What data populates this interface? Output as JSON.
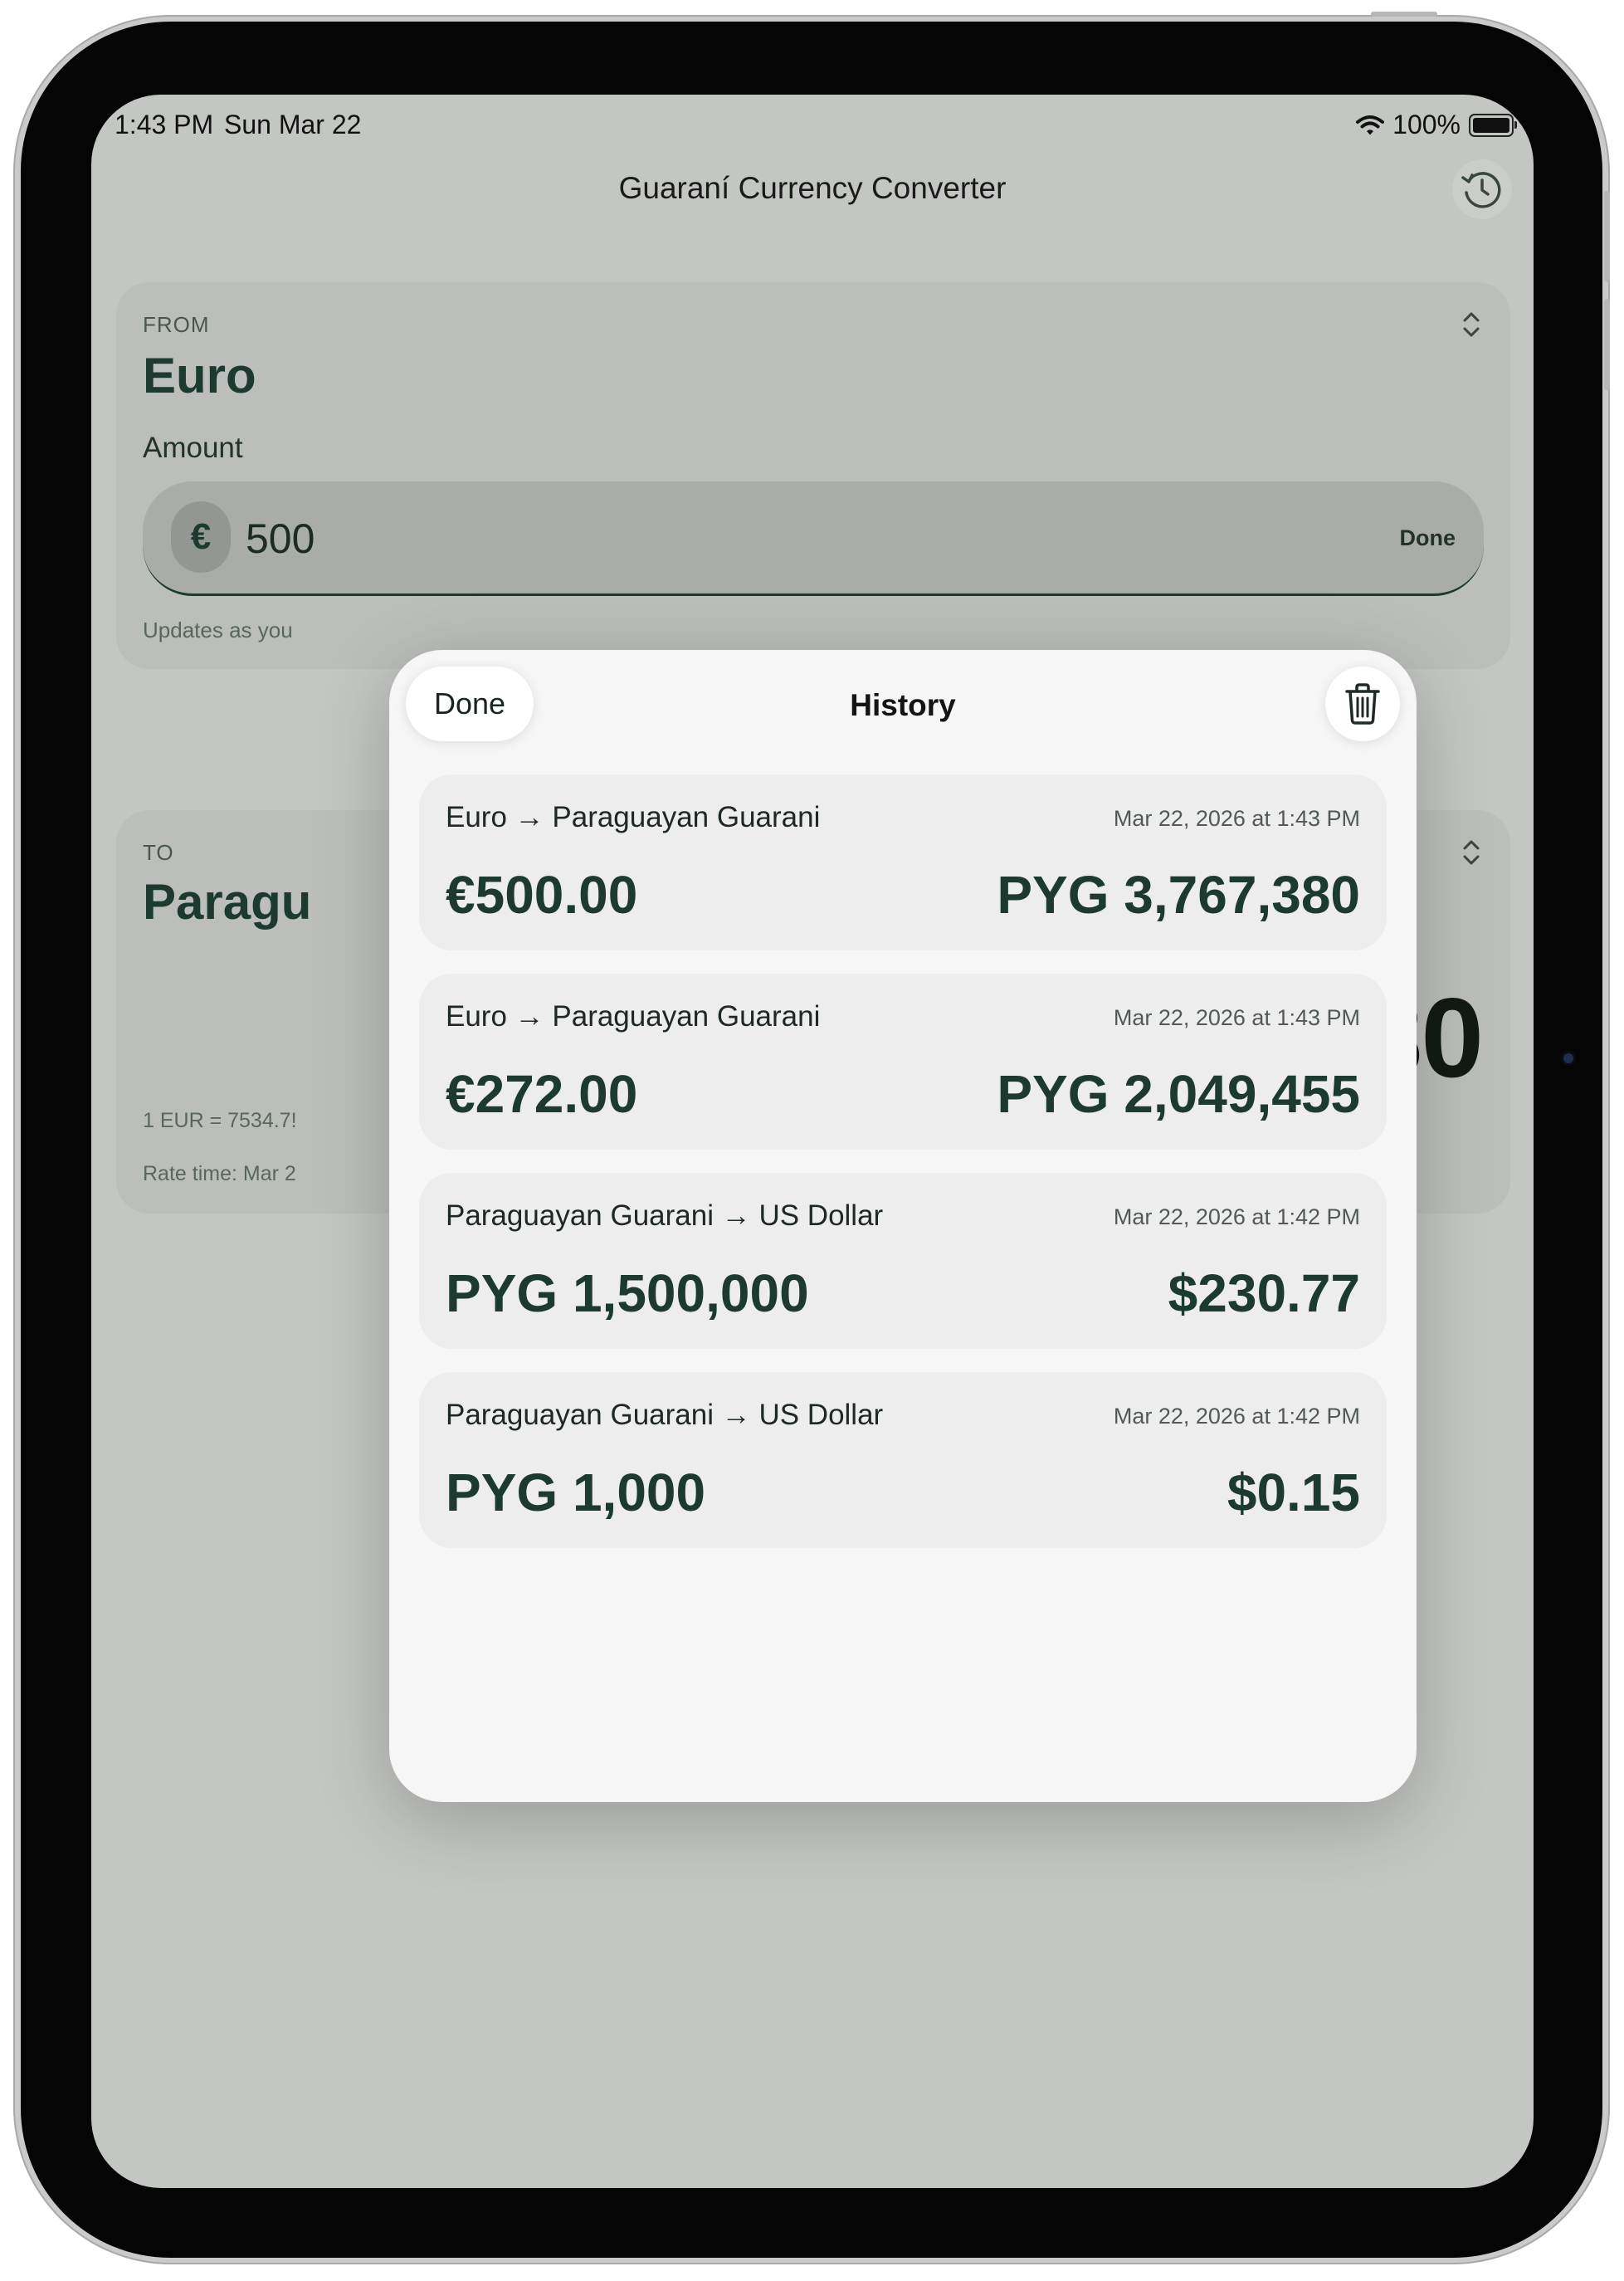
{
  "status_bar": {
    "time": "1:43 PM",
    "date": "Sun Mar 22",
    "battery": "100%"
  },
  "nav": {
    "title": "Guaraní Currency Converter",
    "history_icon": "clock-history-icon"
  },
  "from_card": {
    "label": "FROM",
    "currency": "Euro",
    "amount_label": "Amount",
    "currency_symbol": "€",
    "amount_value": "500",
    "done_label": "Done",
    "helper_text": "Updates as you"
  },
  "to_card": {
    "label": "TO",
    "currency": "Paragu",
    "result_visible": "380",
    "rate": "1 EUR = 7534.7!",
    "rate_time": "Rate time: Mar 2"
  },
  "history_modal": {
    "done_label": "Done",
    "title": "History",
    "clear_icon": "trash-icon",
    "items": [
      {
        "pair": "Euro → Paraguayan Guarani",
        "time": "Mar 22, 2026 at 1:43 PM",
        "from_amount": "€500.00",
        "to_amount": "PYG 3,767,380"
      },
      {
        "pair": "Euro → Paraguayan Guarani",
        "time": "Mar 22, 2026 at 1:43 PM",
        "from_amount": "€272.00",
        "to_amount": "PYG 2,049,455"
      },
      {
        "pair": "Paraguayan Guarani → US Dollar",
        "time": "Mar 22, 2026 at 1:42 PM",
        "from_amount": "PYG 1,500,000",
        "to_amount": "$230.77"
      },
      {
        "pair": "Paraguayan Guarani → US Dollar",
        "time": "Mar 22, 2026 at 1:42 PM",
        "from_amount": "PYG 1,000",
        "to_amount": "$0.15"
      }
    ]
  },
  "colors": {
    "accent": "#1c3a2f",
    "dimmed_background": "#c4c6c3",
    "sheet_background": "#f5f6f5",
    "row_background": "#ecedec"
  }
}
